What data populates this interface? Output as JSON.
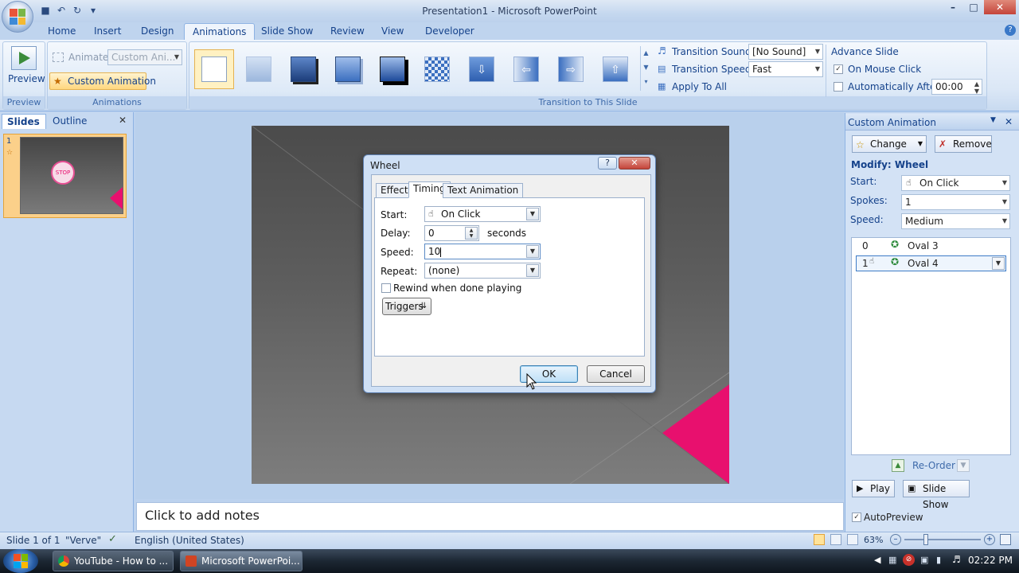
{
  "window": {
    "title": "Presentation1 - Microsoft PowerPoint"
  },
  "colors": {
    "ribbon_bg": "#dbe7f6",
    "accent": "#15428b",
    "slide_pink": "#e8106e",
    "selection": "#fff1c2"
  },
  "icons": {
    "office": "office-button-icon",
    "save": "save-icon",
    "undo": "undo-icon",
    "redo": "redo-icon",
    "help": "help-icon"
  },
  "tabs": [
    "Home",
    "Insert",
    "Design",
    "Animations",
    "Slide Show",
    "Review",
    "View",
    "Developer"
  ],
  "ribbon": {
    "preview": {
      "label": "Preview",
      "group": "Preview"
    },
    "animations": {
      "animate_label": "Animate:",
      "animate_value": "Custom Ani...",
      "custom_anim": "Custom Animation",
      "group": "Animations"
    },
    "transition": {
      "group": "Transition to This Slide",
      "sound_label": "Transition Sound:",
      "sound_value": "[No Sound]",
      "speed_label": "Transition Speed:",
      "speed_value": "Fast",
      "apply_all": "Apply To All"
    },
    "advance": {
      "title": "Advance Slide",
      "on_click": "On Mouse Click",
      "auto_label": "Automatically After:",
      "auto_value": "00:00"
    }
  },
  "left_pane": {
    "tab_slides": "Slides",
    "tab_outline": "Outline",
    "slide_number": "1",
    "thumb_text": "STOP"
  },
  "notes": {
    "placeholder": "Click to add notes"
  },
  "custom_animation": {
    "title": "Custom Animation",
    "change": "Change",
    "remove": "Remove",
    "modify": "Modify: Wheel",
    "start_label": "Start:",
    "start_value": "On Click",
    "spokes_label": "Spokes:",
    "spokes_value": "1",
    "speed_label": "Speed:",
    "speed_value": "Medium",
    "items": [
      {
        "num": "0",
        "name": "Oval 3"
      },
      {
        "num": "1",
        "name": "Oval 4"
      }
    ],
    "reorder": "Re-Order",
    "play": "Play",
    "slideshow": "Slide Show",
    "autopreview": "AutoPreview"
  },
  "dialog": {
    "title": "Wheel",
    "help": "?",
    "tabs": [
      "Effect",
      "Timing",
      "Text Animation"
    ],
    "start_label": "Start:",
    "start_value": "On Click",
    "delay_label": "Delay:",
    "delay_value": "0",
    "delay_unit": "seconds",
    "speed_label": "Speed:",
    "speed_value": "10",
    "repeat_label": "Repeat:",
    "repeat_value": "(none)",
    "rewind": "Rewind when done playing",
    "triggers": "Triggers",
    "ok": "OK",
    "cancel": "Cancel"
  },
  "status": {
    "slide": "Slide 1 of 1",
    "theme": "\"Verve\"",
    "language": "English (United States)",
    "zoom": "63%"
  },
  "taskbar": {
    "items": [
      "YouTube - How to ...",
      "Microsoft PowerPoi..."
    ],
    "clock": "02:22 PM"
  }
}
